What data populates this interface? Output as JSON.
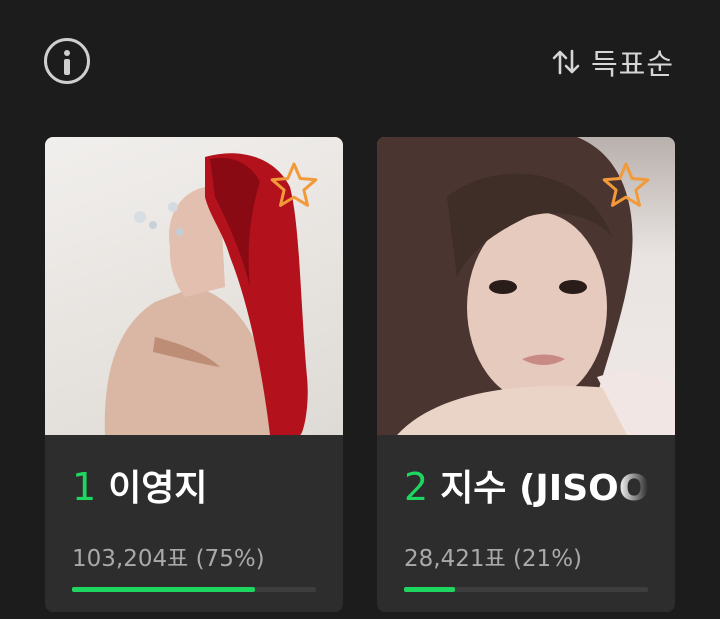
{
  "toolbar": {
    "info_icon": "info-circle-icon",
    "sort_icon": "swap-vertical-icon",
    "sort_label": "득표순"
  },
  "candidates": [
    {
      "rank": "1",
      "name": "이영지",
      "votes_text": "103,204표 (75%)",
      "share": 0.75,
      "favorite_icon": "star-outline-icon"
    },
    {
      "rank": "2",
      "name": "지수 (JISOO)",
      "votes_text": "28,421표 (21%)",
      "share": 0.21,
      "favorite_icon": "star-outline-icon"
    }
  ],
  "colors": {
    "background": "#1c1c1c",
    "card": "#2d2d2d",
    "accent_green": "#1ed760",
    "star_orange": "#f29a3a",
    "muted_text": "#a9a9a9"
  }
}
